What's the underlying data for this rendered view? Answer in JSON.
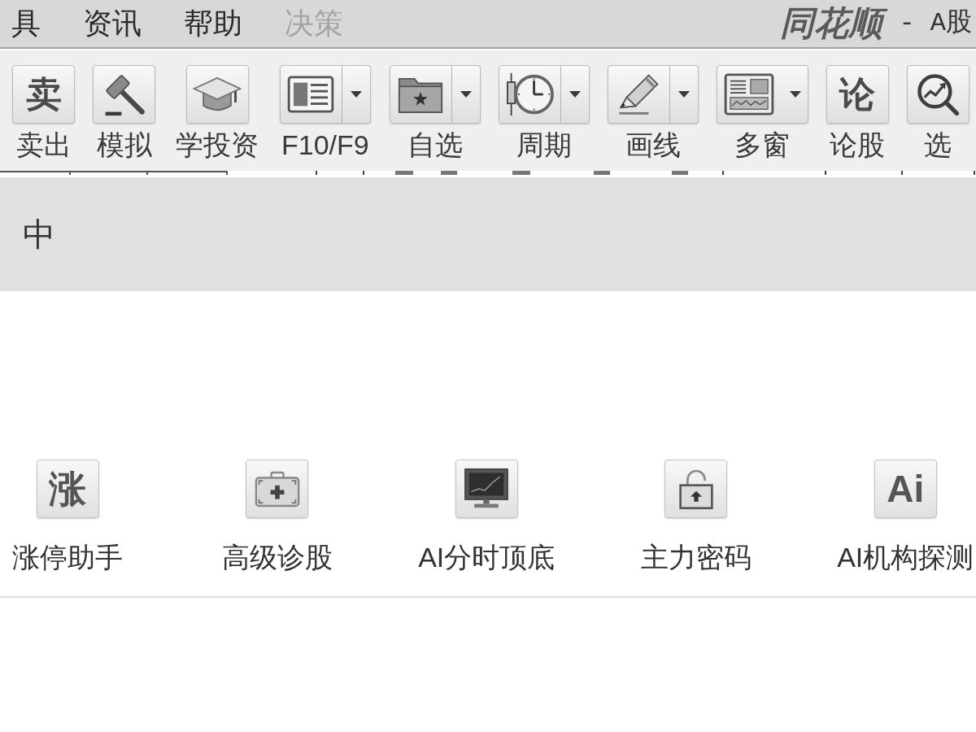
{
  "menu_bar": {
    "items": [
      {
        "label": "具",
        "disabled": false
      },
      {
        "label": "资讯",
        "disabled": false
      },
      {
        "label": "帮助",
        "disabled": false
      },
      {
        "label": "决策",
        "disabled": true
      }
    ],
    "logo": "同花顺",
    "title": "- A股"
  },
  "toolbar": {
    "buttons": [
      {
        "label": "卖出",
        "kind": "plain",
        "glyph": "卖"
      },
      {
        "label": "模拟",
        "kind": "plain"
      },
      {
        "label": "学投资",
        "kind": "plain"
      },
      {
        "label": "F10/F9",
        "kind": "split"
      },
      {
        "label": "自选",
        "kind": "split"
      },
      {
        "label": "周期",
        "kind": "split"
      },
      {
        "label": "画线",
        "kind": "split"
      },
      {
        "label": "多窗",
        "kind": "dropdown"
      },
      {
        "label": "论股",
        "kind": "plain",
        "glyph": "论"
      },
      {
        "label": "选",
        "kind": "plain"
      }
    ]
  },
  "banner": {
    "text": "中"
  },
  "features": [
    {
      "label": "涨停助手",
      "glyph": "涨"
    },
    {
      "label": "高级诊股"
    },
    {
      "label": "AI分时顶底"
    },
    {
      "label": "主力密码"
    },
    {
      "label": "AI机构探测",
      "glyph": "Ai"
    }
  ]
}
